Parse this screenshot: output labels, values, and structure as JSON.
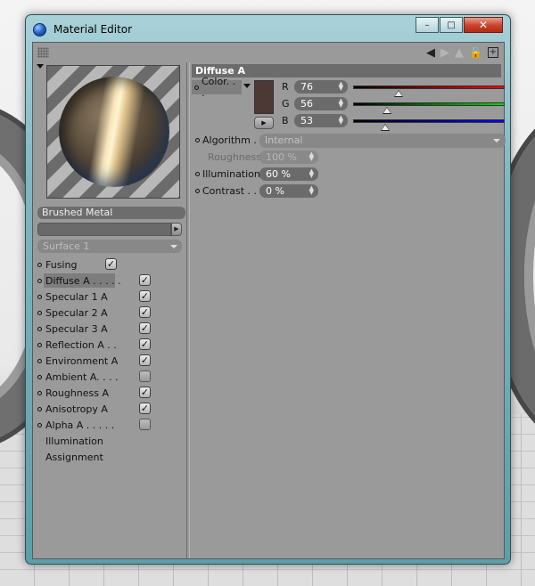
{
  "window": {
    "title": "Material Editor",
    "buttons": {
      "minimize": "–",
      "maximize": "□",
      "close": "✕"
    }
  },
  "toolbar": {
    "back_icon": "back-arrow-icon",
    "forward_icon": "forward-arrow-icon",
    "lock_icon": "lock-icon",
    "new_window_icon": "new-window-icon"
  },
  "material": {
    "name": "Brushed Metal",
    "surface": "Surface 1"
  },
  "channels": [
    {
      "label": "Fusing",
      "checked": true,
      "dot": true
    },
    {
      "label": "Diffuse A . . . . .",
      "checked": true,
      "dot": true,
      "active": true
    },
    {
      "label": "Specular 1 A",
      "checked": true,
      "dot": true
    },
    {
      "label": "Specular 2 A",
      "checked": true,
      "dot": true
    },
    {
      "label": "Specular 3 A",
      "checked": true,
      "dot": true
    },
    {
      "label": "Reflection A . .",
      "checked": true,
      "dot": true
    },
    {
      "label": "Environment A",
      "checked": true,
      "dot": true
    },
    {
      "label": "Ambient A. . . .",
      "checked": false,
      "dot": true
    },
    {
      "label": "Roughness A",
      "checked": true,
      "dot": true
    },
    {
      "label": "Anisotropy A",
      "checked": true,
      "dot": true
    },
    {
      "label": "Alpha A . . . . .",
      "checked": false,
      "dot": true
    },
    {
      "label": "Illumination",
      "checked": null,
      "dot": false
    },
    {
      "label": "Assignment",
      "checked": null,
      "dot": false
    }
  ],
  "diffuse": {
    "header": "Diffuse A",
    "color_label": "Color. . .",
    "swatch_color": "#4c3835",
    "r": {
      "label": "R",
      "value": "76",
      "level": 0.298,
      "colors": [
        "#000000",
        "#ff0000"
      ]
    },
    "g": {
      "label": "G",
      "value": "56",
      "level": 0.22,
      "colors": [
        "#000000",
        "#00e000"
      ]
    },
    "b": {
      "label": "B",
      "value": "53",
      "level": 0.208,
      "colors": [
        "#000000",
        "#0000ff"
      ]
    },
    "algorithm_label": "Algorithm  .",
    "algorithm_value": "Internal",
    "roughness_label": "Roughness",
    "roughness_value": "100 %",
    "illumination_label": "Illumination",
    "illumination_value": "60 %",
    "contrast_label": "Contrast  . .",
    "contrast_value": "0 %"
  },
  "colors": {
    "panel_bg": "#9a9a9a",
    "field_bg": "#6b6b6b",
    "header_bg": "#6c6c6c",
    "frame": "#7fb8c3"
  }
}
